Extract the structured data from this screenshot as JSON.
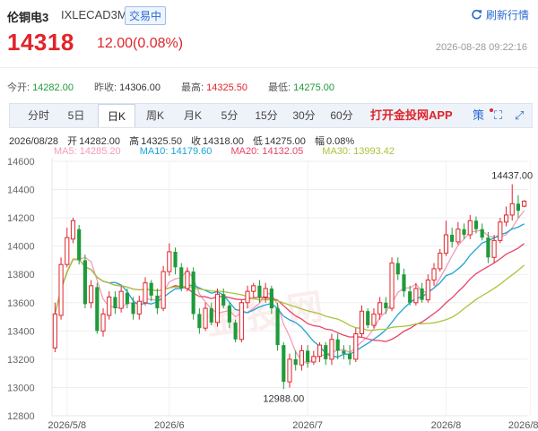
{
  "header": {
    "name": "伦铜电3",
    "code": "IXLECAD3M",
    "status": "交易中",
    "refresh_label": "刷新行情",
    "price": "14318",
    "change": "12.00(0.08%)",
    "time": "2026-08-28 09:22:16"
  },
  "stats": [
    {
      "label": "今开:",
      "value": "14282.00",
      "color": "#1e9b3a"
    },
    {
      "label": "昨收:",
      "value": "14306.00",
      "color": "#333333"
    },
    {
      "label": "最高:",
      "value": "14325.50",
      "color": "#e0242b"
    },
    {
      "label": "最低:",
      "value": "14275.00",
      "color": "#1e9b3a"
    }
  ],
  "tabs": [
    "分时",
    "5日",
    "日K",
    "周K",
    "月K",
    "5分",
    "15分",
    "30分",
    "60分"
  ],
  "active_tab": "日K",
  "app_label": "打开金投网APP",
  "tools": {
    "strategy": "策",
    "fullscreen": "⛶",
    "expand": "⤢"
  },
  "info": {
    "date": "2026/08/28",
    "items": [
      {
        "label": "开",
        "value": "14282.00"
      },
      {
        "label": "高",
        "value": "14325.50"
      },
      {
        "label": "收",
        "value": "14318.00"
      },
      {
        "label": "低",
        "value": "14275.00"
      },
      {
        "label": "幅",
        "value": "0.08%"
      }
    ]
  },
  "ma_legend": [
    {
      "label": "MA5: 14285.20",
      "color": "#f39bb7"
    },
    {
      "label": "MA10: 14179.60",
      "color": "#1aa5d6"
    },
    {
      "label": "MA20: 14132.05",
      "color": "#e8436a"
    },
    {
      "label": "MA30: 13993.42",
      "color": "#a9c43a"
    }
  ],
  "watermark": "金投网",
  "chart_data": {
    "type": "candlestick",
    "y_ticks": [
      14600,
      14400,
      14200,
      14000,
      13800,
      13600,
      13400,
      13200,
      13000,
      12800
    ],
    "ylim": [
      12800,
      14600
    ],
    "x_labels": [
      {
        "label": "2026/5/8",
        "index": 2
      },
      {
        "label": "2026/6",
        "index": 19
      },
      {
        "label": "2026/7",
        "index": 42
      },
      {
        "label": "2026/8",
        "index": 65
      },
      {
        "label": "2026/8/28",
        "index": 79
      }
    ],
    "annotations": [
      {
        "label": "14437.00",
        "index": 76,
        "value": 14437
      },
      {
        "label": "12988.00",
        "index": 38,
        "value": 12988
      }
    ],
    "up_color": "#e0242b",
    "down_color": "#1e9b3a",
    "candles": [
      [
        13280,
        13520,
        13250,
        13600
      ],
      [
        13510,
        13870,
        13480,
        13920
      ],
      [
        13870,
        14060,
        13850,
        14130
      ],
      [
        14050,
        14180,
        14020,
        14200
      ],
      [
        14120,
        13900,
        13870,
        14150
      ],
      [
        13900,
        13590,
        13560,
        13940
      ],
      [
        13600,
        13720,
        13560,
        13760
      ],
      [
        13710,
        13400,
        13380,
        13740
      ],
      [
        13400,
        13520,
        13360,
        13560
      ],
      [
        13510,
        13640,
        13480,
        13680
      ],
      [
        13640,
        13560,
        13520,
        13680
      ],
      [
        13560,
        13680,
        13530,
        13720
      ],
      [
        13670,
        13590,
        13560,
        13700
      ],
      [
        13600,
        13520,
        13480,
        13640
      ],
      [
        13520,
        13610,
        13480,
        13650
      ],
      [
        13600,
        13740,
        13580,
        13780
      ],
      [
        13740,
        13650,
        13610,
        13760
      ],
      [
        13650,
        13560,
        13520,
        13700
      ],
      [
        13560,
        13820,
        13540,
        13860
      ],
      [
        13820,
        13960,
        13790,
        14020
      ],
      [
        13960,
        13850,
        13800,
        13990
      ],
      [
        13850,
        13700,
        13680,
        13880
      ],
      [
        13700,
        13820,
        13680,
        13850
      ],
      [
        13820,
        13520,
        13480,
        13850
      ],
      [
        13520,
        13420,
        13380,
        13560
      ],
      [
        13420,
        13560,
        13400,
        13600
      ],
      [
        13560,
        13460,
        13440,
        13600
      ],
      [
        13460,
        13660,
        13430,
        13700
      ],
      [
        13660,
        13580,
        13560,
        13700
      ],
      [
        13580,
        13460,
        13420,
        13600
      ],
      [
        13460,
        13340,
        13320,
        13480
      ],
      [
        13340,
        13600,
        13320,
        13620
      ],
      [
        13600,
        13680,
        13560,
        13720
      ],
      [
        13680,
        13720,
        13640,
        13740
      ],
      [
        13720,
        13640,
        13600,
        13760
      ],
      [
        13640,
        13700,
        13600,
        13740
      ],
      [
        13700,
        13560,
        13520,
        13720
      ],
      [
        13560,
        13300,
        13260,
        13600
      ],
      [
        13300,
        13040,
        12988,
        13320
      ],
      [
        13040,
        13200,
        13000,
        13240
      ],
      [
        13200,
        13160,
        13120,
        13260
      ],
      [
        13160,
        13260,
        13120,
        13300
      ],
      [
        13260,
        13180,
        13140,
        13300
      ],
      [
        13180,
        13220,
        13160,
        13260
      ],
      [
        13220,
        13300,
        13180,
        13320
      ],
      [
        13300,
        13200,
        13160,
        13320
      ],
      [
        13200,
        13340,
        13160,
        13380
      ],
      [
        13340,
        13260,
        13200,
        13380
      ],
      [
        13260,
        13240,
        13200,
        13300
      ],
      [
        13240,
        13200,
        13160,
        13300
      ],
      [
        13200,
        13380,
        13180,
        13420
      ],
      [
        13380,
        13540,
        13360,
        13580
      ],
      [
        13540,
        13440,
        13420,
        13560
      ],
      [
        13440,
        13520,
        13420,
        13560
      ],
      [
        13520,
        13600,
        13480,
        13640
      ],
      [
        13600,
        13560,
        13520,
        13640
      ],
      [
        13560,
        13880,
        13540,
        13920
      ],
      [
        13880,
        13800,
        13760,
        13920
      ],
      [
        13800,
        13680,
        13640,
        13840
      ],
      [
        13680,
        13600,
        13580,
        13720
      ],
      [
        13600,
        13700,
        13580,
        13740
      ],
      [
        13700,
        13620,
        13600,
        13740
      ],
      [
        13620,
        13760,
        13600,
        13800
      ],
      [
        13760,
        13840,
        13720,
        13880
      ],
      [
        13840,
        13950,
        13820,
        13980
      ],
      [
        13950,
        14080,
        13930,
        14180
      ],
      [
        14080,
        14030,
        13990,
        14130
      ],
      [
        14030,
        14120,
        14010,
        14170
      ],
      [
        14120,
        14080,
        14050,
        14160
      ],
      [
        14080,
        14180,
        14050,
        14220
      ],
      [
        14180,
        14120,
        14090,
        14210
      ],
      [
        14120,
        14060,
        14040,
        14160
      ],
      [
        14060,
        13920,
        13880,
        14100
      ],
      [
        13920,
        14040,
        13880,
        14080
      ],
      [
        14040,
        14170,
        14020,
        14200
      ],
      [
        14170,
        14220,
        14140,
        14280
      ],
      [
        14220,
        14300,
        14180,
        14437
      ],
      [
        14300,
        14250,
        14200,
        14360
      ],
      [
        14282,
        14318,
        14275,
        14325.5
      ]
    ]
  }
}
